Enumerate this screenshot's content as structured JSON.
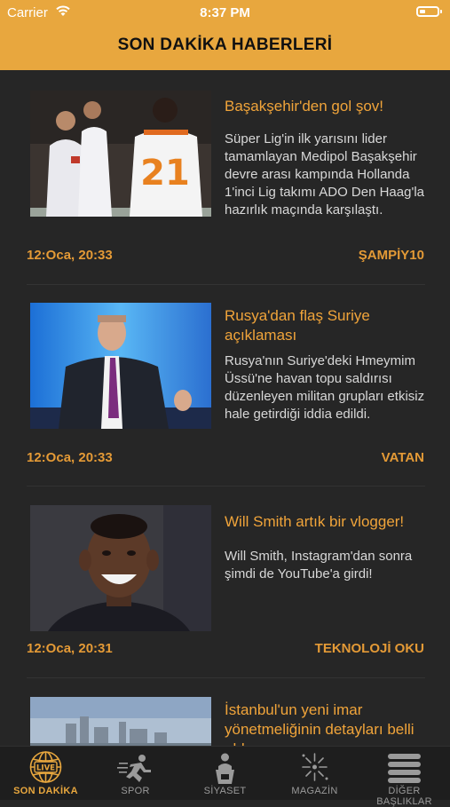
{
  "status_bar": {
    "carrier": "Carrier",
    "time": "8:37 PM"
  },
  "header": {
    "title": "SON DAKİKA HABERLERİ"
  },
  "articles": [
    {
      "title": "Başakşehir'den gol şov!",
      "summary": "Süper Lig'in ilk yarısını lider tamamlayan Medipol Başakşehir devre arası kampında Hollanda 1'inci Lig takımı ADO Den Haag'la hazırlık maçında karşılaştı.",
      "time": "12:Oca, 20:33",
      "source": "ŞAMPİY10",
      "jersey_number": "21"
    },
    {
      "title": "Rusya'dan flaş Suriye açıklaması",
      "summary": "Rusya'nın Suriye'deki Hmeymim Üssü'ne havan topu saldırısı düzenleyen militan grupları etkisiz hale getirdiği iddia edildi.",
      "time": "12:Oca, 20:33",
      "source": "VATAN"
    },
    {
      "title": "Will Smith artık bir vlogger!",
      "summary": "Will Smith, Instagram'dan sonra şimdi de YouTube'a girdi!",
      "time": "12:Oca, 20:31",
      "source": "TEKNOLOJİ OKU"
    },
    {
      "title": "İstanbul'un yeni imar yönetmeliğinin detayları belli oldu",
      "summary": "",
      "time": "",
      "source": ""
    }
  ],
  "tabs": [
    {
      "label": "SON DAKİKA",
      "icon": "globe-live-icon",
      "active": true
    },
    {
      "label": "SPOR",
      "icon": "runner-icon",
      "active": false
    },
    {
      "label": "SİYASET",
      "icon": "podium-speaker-icon",
      "active": false
    },
    {
      "label": "MAGAZİN",
      "icon": "fireworks-icon",
      "active": false
    },
    {
      "label": "DİĞER BAŞLIKLAR",
      "icon": "list-icon",
      "active": false
    }
  ],
  "colors": {
    "accent": "#E8A73E",
    "background": "#262626",
    "text_primary": "#F0A43A",
    "text_body": "#D8D8D8"
  },
  "battery_level": 0.35,
  "live_badge": "LIVE"
}
